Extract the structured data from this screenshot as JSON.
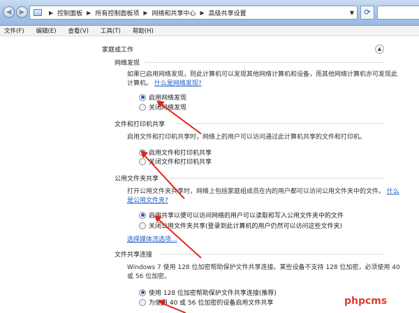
{
  "window": {
    "breadcrumb": [
      "控制面板",
      "所有控制面板项",
      "网络和共享中心",
      "高级共享设置"
    ],
    "nav_back_icon": "back-arrow-icon",
    "nav_forward_icon": "forward-arrow-icon",
    "refresh_icon": "refresh-icon"
  },
  "menu": [
    "文件(F)",
    "编辑(E)",
    "查看(V)",
    "工具(T)",
    "帮助(H)"
  ],
  "profile": {
    "title": "家庭或工作"
  },
  "sections": {
    "discovery": {
      "title": "网络发现",
      "desc_line1": "如果已启用网络发现，则此计算机可以发现其他网络计算机和设备，而其他网络计算机亦可发现此",
      "desc_line2_prefix": "计算机。",
      "link": "什么是网络发现?",
      "options": [
        "启用网络发现",
        "关闭网络发现"
      ]
    },
    "file_printer": {
      "title": "文件和打印机共享",
      "desc": "启用文件和打印机共享时，网络上的用户可以访问通过此计算机共享的文件和打印机。",
      "options": [
        "启用文件和打印机共享",
        "关闭文件和打印机共享"
      ]
    },
    "public": {
      "title": "公用文件夹共享",
      "desc_line1": "打开公用文件夹共享时，网络上包括家庭组成员在内的用户都可以访问公用文件夹中的文件。",
      "desc_link_part1": "什么",
      "desc_link_part2": "是公用文件夹?",
      "options": [
        "启用共享以便可以访问网络的用户可以读取和写入公用文件夹中的文件",
        "关闭公用文件夹共享(登录到此计算机的用户仍然可以访问这些文件夹)"
      ]
    },
    "media": {
      "link": "选择媒体流选项..."
    },
    "connections": {
      "title": "文件共享连接",
      "desc_line1": "Windows 7 使用 128 位加密帮助保护文件共享连接。某些设备不支持 128 位加密，必须使用 40",
      "desc_line2": "或 56 位加密。",
      "options": [
        "使用 128 位加密帮助保护文件共享连接(推荐)",
        "为使用 40 或 56 位加密的设备启用文件共享"
      ]
    }
  },
  "colors": {
    "arrow": "#e0241b",
    "link": "#1e5cc8",
    "watermark": "#e53a2f"
  },
  "watermark": "phpcms"
}
